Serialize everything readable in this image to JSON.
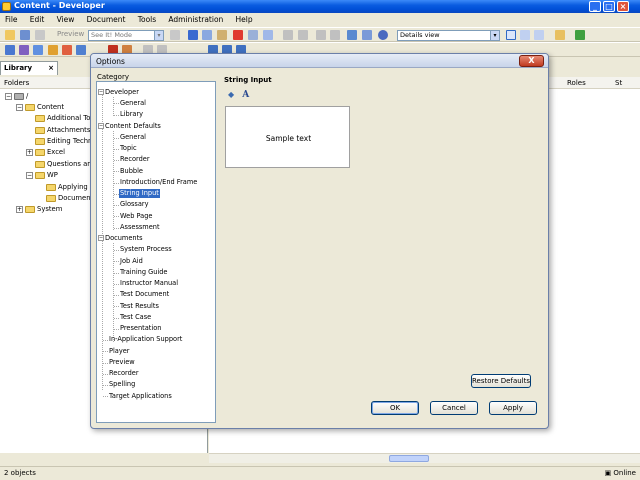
{
  "window": {
    "title": "Content - Developer"
  },
  "menubar": [
    "File",
    "Edit",
    "View",
    "Document",
    "Tools",
    "Administration",
    "Help"
  ],
  "toolbar1": {
    "preview_label": "Preview",
    "mode_value": "See It! Mode"
  },
  "toolbar2": {
    "view_value": "Details view"
  },
  "library": {
    "tab_label": "Library",
    "folders_header": "Folders",
    "tree": [
      {
        "label": "/",
        "level": 0
      },
      {
        "label": "Content",
        "level": 1
      },
      {
        "label": "Additional Top",
        "level": 2
      },
      {
        "label": "Attachments",
        "level": 2
      },
      {
        "label": "Editing Techni",
        "level": 2
      },
      {
        "label": "Excel",
        "level": 2
      },
      {
        "label": "Questions and",
        "level": 2
      },
      {
        "label": "WP",
        "level": 2
      },
      {
        "label": "Applying F",
        "level": 3
      },
      {
        "label": "Documen",
        "level": 3
      },
      {
        "label": "System",
        "level": 1
      }
    ]
  },
  "rightpane": {
    "col_roles": "Roles",
    "col_st": "St"
  },
  "statusbar": {
    "left": "2 objects",
    "right": "Online"
  },
  "dialog": {
    "title": "Options",
    "close_label": "X",
    "category_label": "Category",
    "categories": [
      {
        "label": "Developer"
      },
      {
        "label": "General"
      },
      {
        "label": "Library"
      },
      {
        "label": "Content Defaults"
      },
      {
        "label": "General"
      },
      {
        "label": "Topic"
      },
      {
        "label": "Recorder"
      },
      {
        "label": "Bubble"
      },
      {
        "label": "Introduction/End Frame"
      },
      {
        "label": "String Input"
      },
      {
        "label": "Glossary"
      },
      {
        "label": "Web Page"
      },
      {
        "label": "Assessment"
      },
      {
        "label": "Documents"
      },
      {
        "label": "System Process"
      },
      {
        "label": "Job Aid"
      },
      {
        "label": "Training Guide"
      },
      {
        "label": "Instructor Manual"
      },
      {
        "label": "Test Document"
      },
      {
        "label": "Test Results"
      },
      {
        "label": "Test Case"
      },
      {
        "label": "Presentation"
      },
      {
        "label": "In-Application Support"
      },
      {
        "label": "Player"
      },
      {
        "label": "Preview"
      },
      {
        "label": "Recorder"
      },
      {
        "label": "Spelling"
      },
      {
        "label": "Target Applications"
      }
    ],
    "section_title": "String Input",
    "font_icon_label": "A",
    "sample_text": "Sample text",
    "restore_defaults": "Restore Defaults",
    "ok": "OK",
    "cancel": "Cancel",
    "apply": "Apply"
  }
}
